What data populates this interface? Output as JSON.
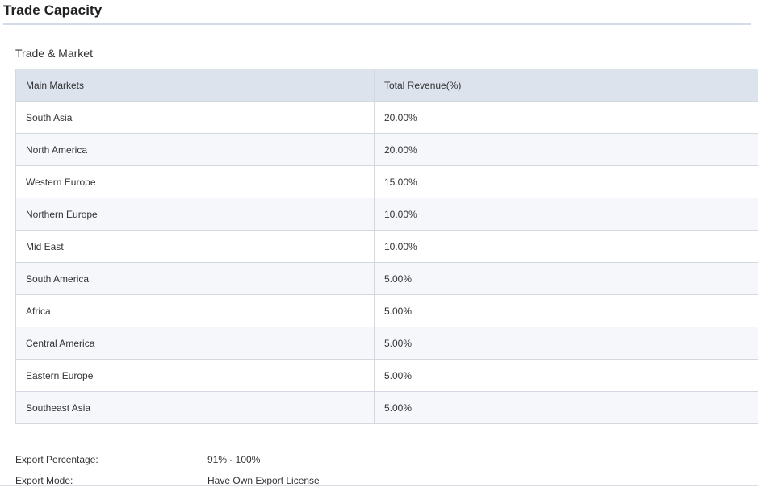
{
  "page": {
    "title": "Trade Capacity"
  },
  "trade_market": {
    "section_title": "Trade & Market",
    "columns": [
      "Main Markets",
      "Total Revenue(%)"
    ],
    "rows": [
      {
        "market": "South Asia",
        "revenue": "20.00%"
      },
      {
        "market": "North America",
        "revenue": "20.00%"
      },
      {
        "market": "Western Europe",
        "revenue": "15.00%"
      },
      {
        "market": "Northern Europe",
        "revenue": "10.00%"
      },
      {
        "market": "Mid East",
        "revenue": "10.00%"
      },
      {
        "market": "South America",
        "revenue": "5.00%"
      },
      {
        "market": "Africa",
        "revenue": "5.00%"
      },
      {
        "market": "Central America",
        "revenue": "5.00%"
      },
      {
        "market": "Eastern Europe",
        "revenue": "5.00%"
      },
      {
        "market": "Southeast Asia",
        "revenue": "5.00%"
      }
    ]
  },
  "export_info": {
    "percentage_label": "Export Percentage:",
    "percentage_value": "91% - 100%",
    "mode_label": "Export Mode:",
    "mode_value": "Have Own Export License"
  },
  "colors": {
    "header_bg": "#dce3ed",
    "row_alt_bg": "#f5f7fa",
    "border": "#d3d8e0",
    "title_rule": "#d4dae6"
  }
}
